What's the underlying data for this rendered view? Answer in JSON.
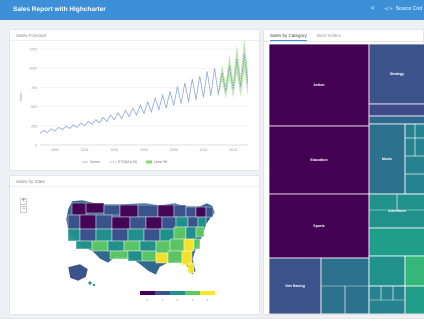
{
  "navbar": {
    "title": "Sales Report with Highcharter",
    "source_label": "Source Cod"
  },
  "forecast": {
    "title": "Sales Forecast",
    "chart_data": {
      "type": "line",
      "x_ticks": [
        "2000",
        "2002",
        "2004",
        "2006",
        "2008",
        "2010",
        "2012"
      ],
      "y_ticks": [
        "0",
        "250",
        "500",
        "750",
        "1000",
        "1250"
      ],
      "ylabel": "Sales",
      "ylim": [
        0,
        1250
      ],
      "xlim": [
        1999,
        2013
      ],
      "series": [
        {
          "name": "Series",
          "style": "line",
          "color": "#8fa8d8",
          "x": [
            1999.0,
            1999.25,
            1999.5,
            1999.75,
            2000.0,
            2000.25,
            2000.5,
            2000.75,
            2001.0,
            2001.25,
            2001.5,
            2001.75,
            2002.0,
            2002.25,
            2002.5,
            2002.75,
            2003.0,
            2003.25,
            2003.5,
            2003.75,
            2004.0,
            2004.25,
            2004.5,
            2004.75,
            2005.0,
            2005.25,
            2005.5,
            2005.75,
            2006.0,
            2006.25,
            2006.5,
            2006.75,
            2007.0,
            2007.25,
            2007.5,
            2007.75,
            2008.0,
            2008.25,
            2008.5,
            2008.75,
            2009.0,
            2009.25,
            2009.5,
            2009.75,
            2010.0,
            2010.25,
            2010.5,
            2010.75,
            2011.0
          ],
          "y": [
            150,
            190,
            165,
            210,
            180,
            230,
            200,
            245,
            215,
            260,
            230,
            285,
            250,
            310,
            270,
            330,
            290,
            360,
            305,
            390,
            330,
            420,
            345,
            450,
            370,
            480,
            390,
            520,
            410,
            560,
            430,
            610,
            460,
            650,
            480,
            700,
            510,
            760,
            540,
            810,
            560,
            860,
            590,
            900,
            620,
            960,
            640,
            1000,
            660
          ]
        },
        {
          "name": "ETS(M,A,M)",
          "style": "dashed",
          "color": "#7a8fb8",
          "x": [
            2011.0,
            2011.25,
            2011.5,
            2011.75,
            2012.0,
            2012.25,
            2012.5,
            2012.75,
            2013.0
          ],
          "y": [
            660,
            940,
            700,
            1030,
            730,
            1120,
            760,
            1180,
            790
          ]
        },
        {
          "name": "Level 95",
          "style": "band",
          "color": "#8cd67a",
          "x": [
            2011.0,
            2011.25,
            2011.5,
            2011.75,
            2012.0,
            2012.25,
            2012.5,
            2012.75,
            2013.0
          ],
          "low": [
            620,
            830,
            600,
            880,
            610,
            930,
            620,
            960,
            630
          ],
          "high": [
            700,
            1050,
            800,
            1180,
            850,
            1310,
            900,
            1400,
            950
          ]
        }
      ]
    }
  },
  "map": {
    "title": "Sales by State",
    "zoom_in": "+",
    "zoom_out": "−",
    "legend_colors": [
      "#440154",
      "#3b528b",
      "#21918c",
      "#5ec962",
      "#fde725"
    ],
    "legend_ticks": [
      "0",
      "1",
      "2",
      "3",
      "4"
    ]
  },
  "treemap": {
    "tabs": [
      "Sales by Category",
      "Best Sellers"
    ],
    "chart_data": {
      "type": "treemap",
      "items": [
        {
          "label": "Action",
          "value": 28,
          "color": "#440154"
        },
        {
          "label": "Education",
          "value": 32,
          "color": "#440154"
        },
        {
          "label": "Sports",
          "value": 23,
          "color": "#440154"
        },
        {
          "label": "Strategy",
          "value": 11,
          "color": "#3b528b"
        },
        {
          "label": "",
          "value": 7,
          "color": "#3e4a89"
        },
        {
          "label": "",
          "value": 3,
          "color": "#31688e"
        },
        {
          "label": "Music",
          "value": 13,
          "color": "#2c728e"
        },
        {
          "label": "",
          "value": 8,
          "color": "#26828e"
        },
        {
          "label": "Adventure",
          "value": 7,
          "color": "#21918c"
        },
        {
          "label": "",
          "value": 6,
          "color": "#1f9e89"
        },
        {
          "label": "Sim Racing",
          "value": 10,
          "color": "#3b528b"
        },
        {
          "label": "",
          "value": 5,
          "color": "#2c728e"
        },
        {
          "label": "",
          "value": 4,
          "color": "#21918c"
        },
        {
          "label": "",
          "value": 4,
          "color": "#35b779"
        },
        {
          "label": "",
          "value": 3,
          "color": "#26828e"
        },
        {
          "label": "",
          "value": 3,
          "color": "#1f9e89"
        }
      ]
    }
  }
}
